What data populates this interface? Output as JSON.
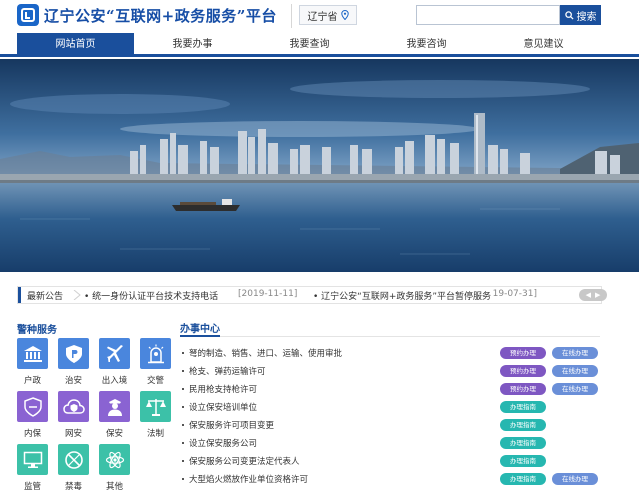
{
  "header": {
    "site_title": "辽宁公安“互联网+政务服务”平台",
    "region": "辽宁省",
    "search_placeholder": "",
    "search_button": "搜索"
  },
  "nav": {
    "items": [
      {
        "label": "网站首页",
        "active": true
      },
      {
        "label": "我要办事",
        "active": false
      },
      {
        "label": "我要查询",
        "active": false
      },
      {
        "label": "我要咨询",
        "active": false
      },
      {
        "label": "意见建议",
        "active": false
      }
    ]
  },
  "notice": {
    "label": "最新公告",
    "items": [
      {
        "text": "• 统一身份认证平台技术支持电话",
        "date": "[2019-11-11]"
      },
      {
        "text": "• 辽宁公安“互联网+政务服务”平台暂停服务",
        "date": "[2019-07-31]"
      }
    ]
  },
  "police_services": {
    "title": "警种服务",
    "items": [
      {
        "label": "户政",
        "icon": "bank-building-icon",
        "color": "#4a86dd"
      },
      {
        "label": "治安",
        "icon": "police-shield-p-icon",
        "color": "#4a86dd"
      },
      {
        "label": "出入境",
        "icon": "airplane-icon",
        "color": "#4a86dd"
      },
      {
        "label": "交警",
        "icon": "traffic-light-icon",
        "color": "#4a86dd"
      },
      {
        "label": "内保",
        "icon": "security-shield-icon",
        "color": "#8a63d2"
      },
      {
        "label": "网安",
        "icon": "cloud-shield-icon",
        "color": "#8a63d2"
      },
      {
        "label": "保安",
        "icon": "guard-person-icon",
        "color": "#8a63d2"
      },
      {
        "label": "法制",
        "icon": "scales-icon",
        "color": "#3cc1a8"
      },
      {
        "label": "监管",
        "icon": "monitor-icon",
        "color": "#3cc1a8"
      },
      {
        "label": "禁毒",
        "icon": "no-drugs-icon",
        "color": "#3cc1a8"
      },
      {
        "label": "其他",
        "icon": "atom-icon",
        "color": "#3cc1a8"
      }
    ]
  },
  "service_center": {
    "title": "办事中心",
    "items": [
      {
        "name": "弩的制造、销售、进口、运输、使用审批",
        "buttons": [
          {
            "label": "预约办理",
            "style": "purple"
          },
          {
            "label": "在线办理",
            "style": "blue"
          }
        ]
      },
      {
        "name": "枪支、弹药运输许可",
        "buttons": [
          {
            "label": "预约办理",
            "style": "purple"
          },
          {
            "label": "在线办理",
            "style": "blue"
          }
        ]
      },
      {
        "name": "民用枪支持枪许可",
        "buttons": [
          {
            "label": "预约办理",
            "style": "purple"
          },
          {
            "label": "在线办理",
            "style": "blue"
          }
        ]
      },
      {
        "name": "设立保安培训单位",
        "buttons": [
          {
            "label": "办理指南",
            "style": "teal"
          }
        ]
      },
      {
        "name": "保安服务许可项目变更",
        "buttons": [
          {
            "label": "办理指南",
            "style": "teal"
          }
        ]
      },
      {
        "name": "设立保安服务公司",
        "buttons": [
          {
            "label": "办理指南",
            "style": "teal"
          }
        ]
      },
      {
        "name": "保安服务公司变更法定代表人",
        "buttons": [
          {
            "label": "办理指南",
            "style": "teal"
          }
        ]
      },
      {
        "name": "大型焰火燃放作业单位资格许可",
        "buttons": [
          {
            "label": "办理指南",
            "style": "teal"
          },
          {
            "label": "在线办理",
            "style": "blue"
          }
        ]
      }
    ]
  },
  "colors": {
    "brand_blue": "#1a4f9c",
    "pill_purple": "#7e57c2",
    "pill_blue": "#6a8fd8",
    "pill_teal": "#26b7b0"
  }
}
